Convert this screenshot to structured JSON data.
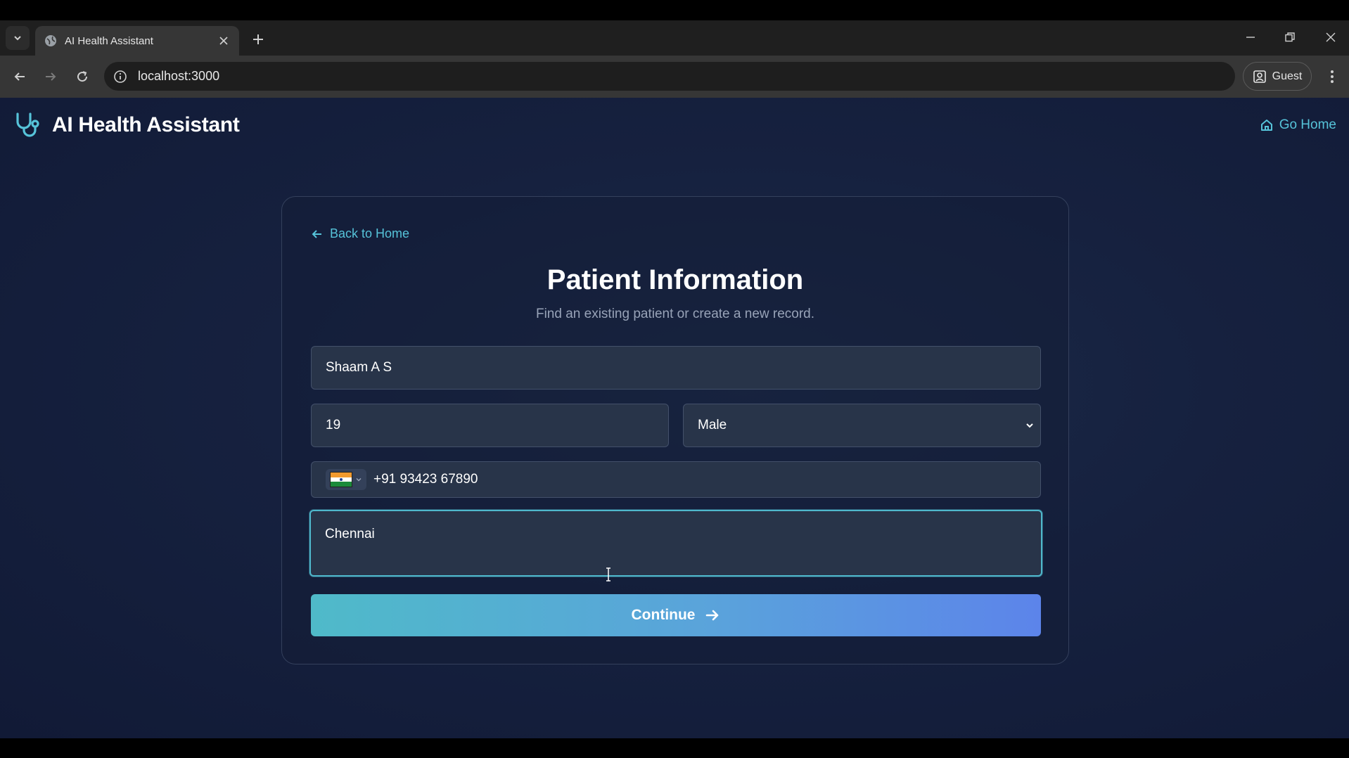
{
  "browser": {
    "tab_title": "AI Health Assistant",
    "url": "localhost:3000",
    "profile_label": "Guest"
  },
  "app": {
    "brand_title": "AI Health Assistant",
    "go_home_label": "Go Home",
    "accent_color": "#56c3d9"
  },
  "form": {
    "back_label": "Back to Home",
    "title": "Patient Information",
    "subtitle": "Find an existing patient or create a new record.",
    "name_value": "Shaam A S",
    "age_value": "19",
    "gender_selected": "Male",
    "phone_value": "+91 93423 67890",
    "country_flag": "india-flag-icon",
    "city_value": "Chennai",
    "continue_label": "Continue"
  }
}
